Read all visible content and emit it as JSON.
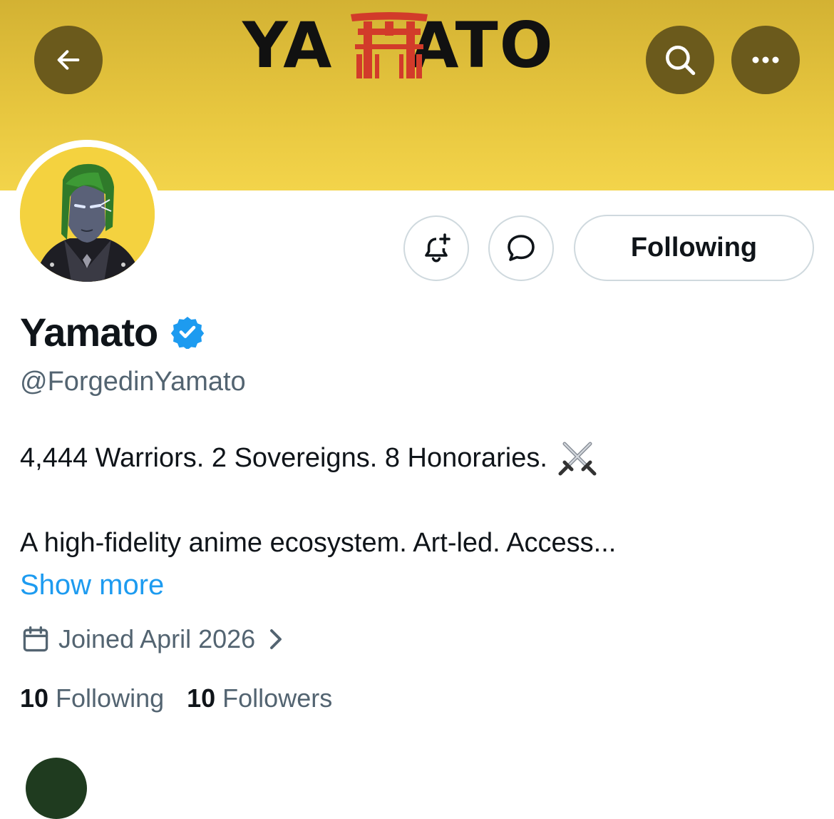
{
  "banner": {
    "logo_text": "YAMATO",
    "colors": {
      "banner_top": "#d3b233",
      "banner_bottom": "#f3d44a",
      "torii": "#d23b2a",
      "circle_button": "#6b5a1c"
    }
  },
  "header": {
    "back_icon": "arrow-left-icon",
    "search_icon": "search-icon",
    "more_icon": "more-horizontal-icon"
  },
  "actions": {
    "notify_icon": "bell-plus-icon",
    "message_icon": "message-bubble-icon",
    "following_label": "Following"
  },
  "profile": {
    "name": "Yamato",
    "verified_icon": "verified-badge-icon",
    "handle": "@ForgedinYamato",
    "bio_line1": "4,444 Warriors. 2 Sovereigns. 8 Honoraries.",
    "bio_emoji": "crossed-swords-icon",
    "bio_line2": "A high-fidelity anime ecosystem. Art-led. Access...",
    "show_more": "Show more",
    "joined": "Joined April 2026",
    "following_count": "10",
    "following_label": "Following",
    "followers_count": "10",
    "followers_label": "Followers"
  },
  "colors": {
    "link": "#1d9bf0",
    "secondary_text": "#536471",
    "verified": "#1d9bf0",
    "border": "#cfd9de"
  }
}
